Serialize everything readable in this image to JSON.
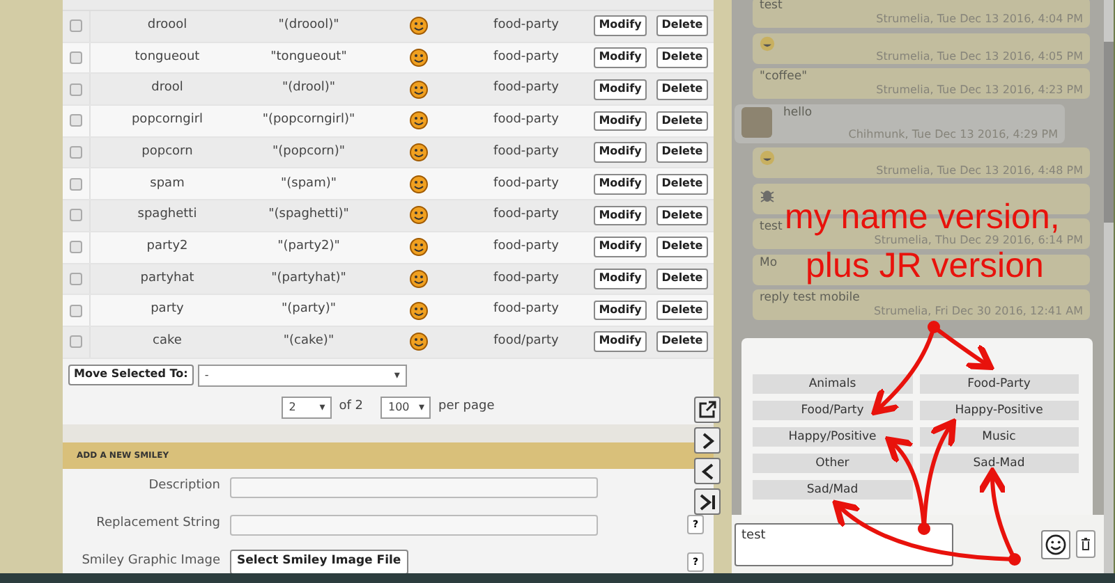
{
  "smileys": {
    "rows": [
      {
        "name": "droool",
        "replacement": "\"(droool)\"",
        "category": "food-party",
        "checked": false,
        "actions": [
          "Modify",
          "Delete"
        ]
      },
      {
        "name": "tongueout",
        "replacement": "\"tongueout\"",
        "category": "food-party",
        "checked": false,
        "actions": [
          "Modify",
          "Delete"
        ]
      },
      {
        "name": "drool",
        "replacement": "\"(drool)\"",
        "category": "food-party",
        "checked": false,
        "actions": [
          "Modify",
          "Delete"
        ]
      },
      {
        "name": "popcorngirl",
        "replacement": "\"(popcorngirl)\"",
        "category": "food-party",
        "checked": false,
        "actions": [
          "Modify",
          "Delete"
        ]
      },
      {
        "name": "popcorn",
        "replacement": "\"(popcorn)\"",
        "category": "food-party",
        "checked": false,
        "actions": [
          "Modify",
          "Delete"
        ]
      },
      {
        "name": "spam",
        "replacement": "\"(spam)\"",
        "category": "food-party",
        "checked": false,
        "actions": [
          "Modify",
          "Delete"
        ]
      },
      {
        "name": "spaghetti",
        "replacement": "\"(spaghetti)\"",
        "category": "food-party",
        "checked": false,
        "actions": [
          "Modify",
          "Delete"
        ]
      },
      {
        "name": "party2",
        "replacement": "\"(party2)\"",
        "category": "food-party",
        "checked": false,
        "actions": [
          "Modify",
          "Delete"
        ]
      },
      {
        "name": "partyhat",
        "replacement": "\"(partyhat)\"",
        "category": "food-party",
        "checked": false,
        "actions": [
          "Modify",
          "Delete"
        ]
      },
      {
        "name": "party",
        "replacement": "\"(party)\"",
        "category": "food-party",
        "checked": false,
        "actions": [
          "Modify",
          "Delete"
        ]
      },
      {
        "name": "cake",
        "replacement": "\"(cake)\"",
        "category": "food/party",
        "checked": false,
        "actions": [
          "Modify",
          "Delete"
        ]
      }
    ],
    "move_selected": {
      "button": "Move Selected To:",
      "value": "-",
      "caret": "▾"
    },
    "pager": {
      "page": "2",
      "page_caret": "▾",
      "of": "of 2",
      "per_page_value": "100",
      "per_page_caret": "▾",
      "per_page_label": "per page"
    }
  },
  "add_form": {
    "title": "ADD A NEW SMILEY",
    "fields": [
      {
        "label": "Description",
        "kind": "text"
      },
      {
        "label": "Replacement String",
        "kind": "text",
        "help": "?"
      },
      {
        "label": "Smiley Graphic Image",
        "kind": "file",
        "button": "Select Smiley Image File",
        "help": "?"
      }
    ]
  },
  "chat": {
    "messages": [
      {
        "kind": "text",
        "text": "test",
        "meta": "Strumelia, Tue Dec 13 2016, 4:04 PM",
        "from_other": false
      },
      {
        "kind": "emoji",
        "meta": "Strumelia, Tue Dec 13 2016, 4:05 PM",
        "from_other": false
      },
      {
        "kind": "text",
        "text": "\"coffee\"",
        "meta": "Strumelia, Tue Dec 13 2016, 4:23 PM",
        "from_other": false
      },
      {
        "kind": "text",
        "text": "hello",
        "meta": "Chihmunk, Tue Dec 13 2016, 4:29 PM",
        "from_other": true
      },
      {
        "kind": "emoji",
        "meta": "Strumelia, Tue Dec 13 2016, 4:48 PM",
        "from_other": false
      },
      {
        "kind": "bug",
        "from_other": false
      },
      {
        "kind": "text",
        "text": "test",
        "meta": "Strumelia, Thu Dec 29 2016, 6:14 PM",
        "from_other": false
      },
      {
        "kind": "text",
        "text": "Mo",
        "from_other": false
      },
      {
        "kind": "text",
        "text": "reply test mobile",
        "meta": "Strumelia, Fri Dec 30 2016, 12:41 AM",
        "from_other": false
      }
    ]
  },
  "category_popup": {
    "buttons": [
      "Animals",
      "Food-Party",
      "Food/Party",
      "Happy-Positive",
      "Happy/Positive",
      "Music",
      "Other",
      "Sad-Mad",
      "Sad/Mad"
    ]
  },
  "composer": {
    "value": "test"
  },
  "annotation": {
    "lines": [
      "my name version,",
      "plus JR version"
    ]
  }
}
